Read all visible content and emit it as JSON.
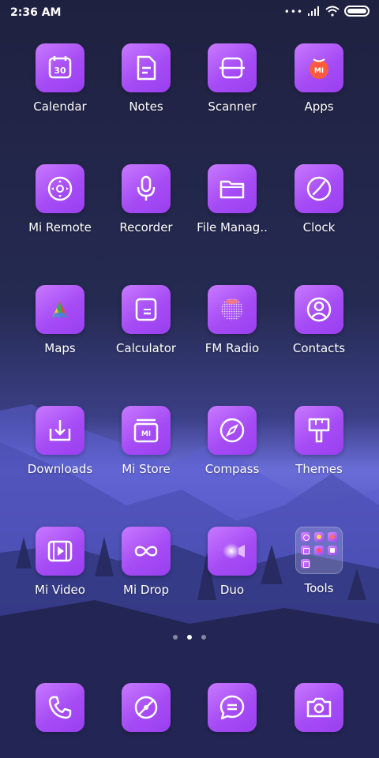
{
  "status_bar": {
    "time": "2:36 AM"
  },
  "apps": [
    {
      "label": "Calendar",
      "icon": "calendar-icon",
      "badge": "30"
    },
    {
      "label": "Notes",
      "icon": "notes-icon"
    },
    {
      "label": "Scanner",
      "icon": "scanner-icon"
    },
    {
      "label": "Apps",
      "icon": "apps-icon",
      "badge": "MI"
    },
    {
      "label": "Mi Remote",
      "icon": "remote-icon"
    },
    {
      "label": "Recorder",
      "icon": "microphone-icon"
    },
    {
      "label": "File Manag..",
      "icon": "folder-icon"
    },
    {
      "label": "Clock",
      "icon": "clock-icon"
    },
    {
      "label": "Maps",
      "icon": "maps-icon"
    },
    {
      "label": "Calculator",
      "icon": "calculator-icon"
    },
    {
      "label": "FM Radio",
      "icon": "radio-icon"
    },
    {
      "label": "Contacts",
      "icon": "contacts-icon"
    },
    {
      "label": "Downloads",
      "icon": "download-icon"
    },
    {
      "label": "Mi Store",
      "icon": "store-icon",
      "badge": "MI"
    },
    {
      "label": "Compass",
      "icon": "compass-icon"
    },
    {
      "label": "Themes",
      "icon": "paintbrush-icon"
    },
    {
      "label": "Mi Video",
      "icon": "video-icon"
    },
    {
      "label": "Mi Drop",
      "icon": "infinity-icon"
    },
    {
      "label": "Duo",
      "icon": "duo-icon"
    },
    {
      "label": "Tools",
      "icon": "folder-tools-icon"
    }
  ],
  "dock": [
    {
      "icon": "phone-icon"
    },
    {
      "icon": "browser-icon"
    },
    {
      "icon": "message-icon"
    },
    {
      "icon": "camera-icon"
    }
  ],
  "pager": {
    "pages": 3,
    "active": 2
  },
  "colors": {
    "tile": "#a64cf5",
    "tile_light": "#c879ff",
    "background": "#1f2140"
  }
}
